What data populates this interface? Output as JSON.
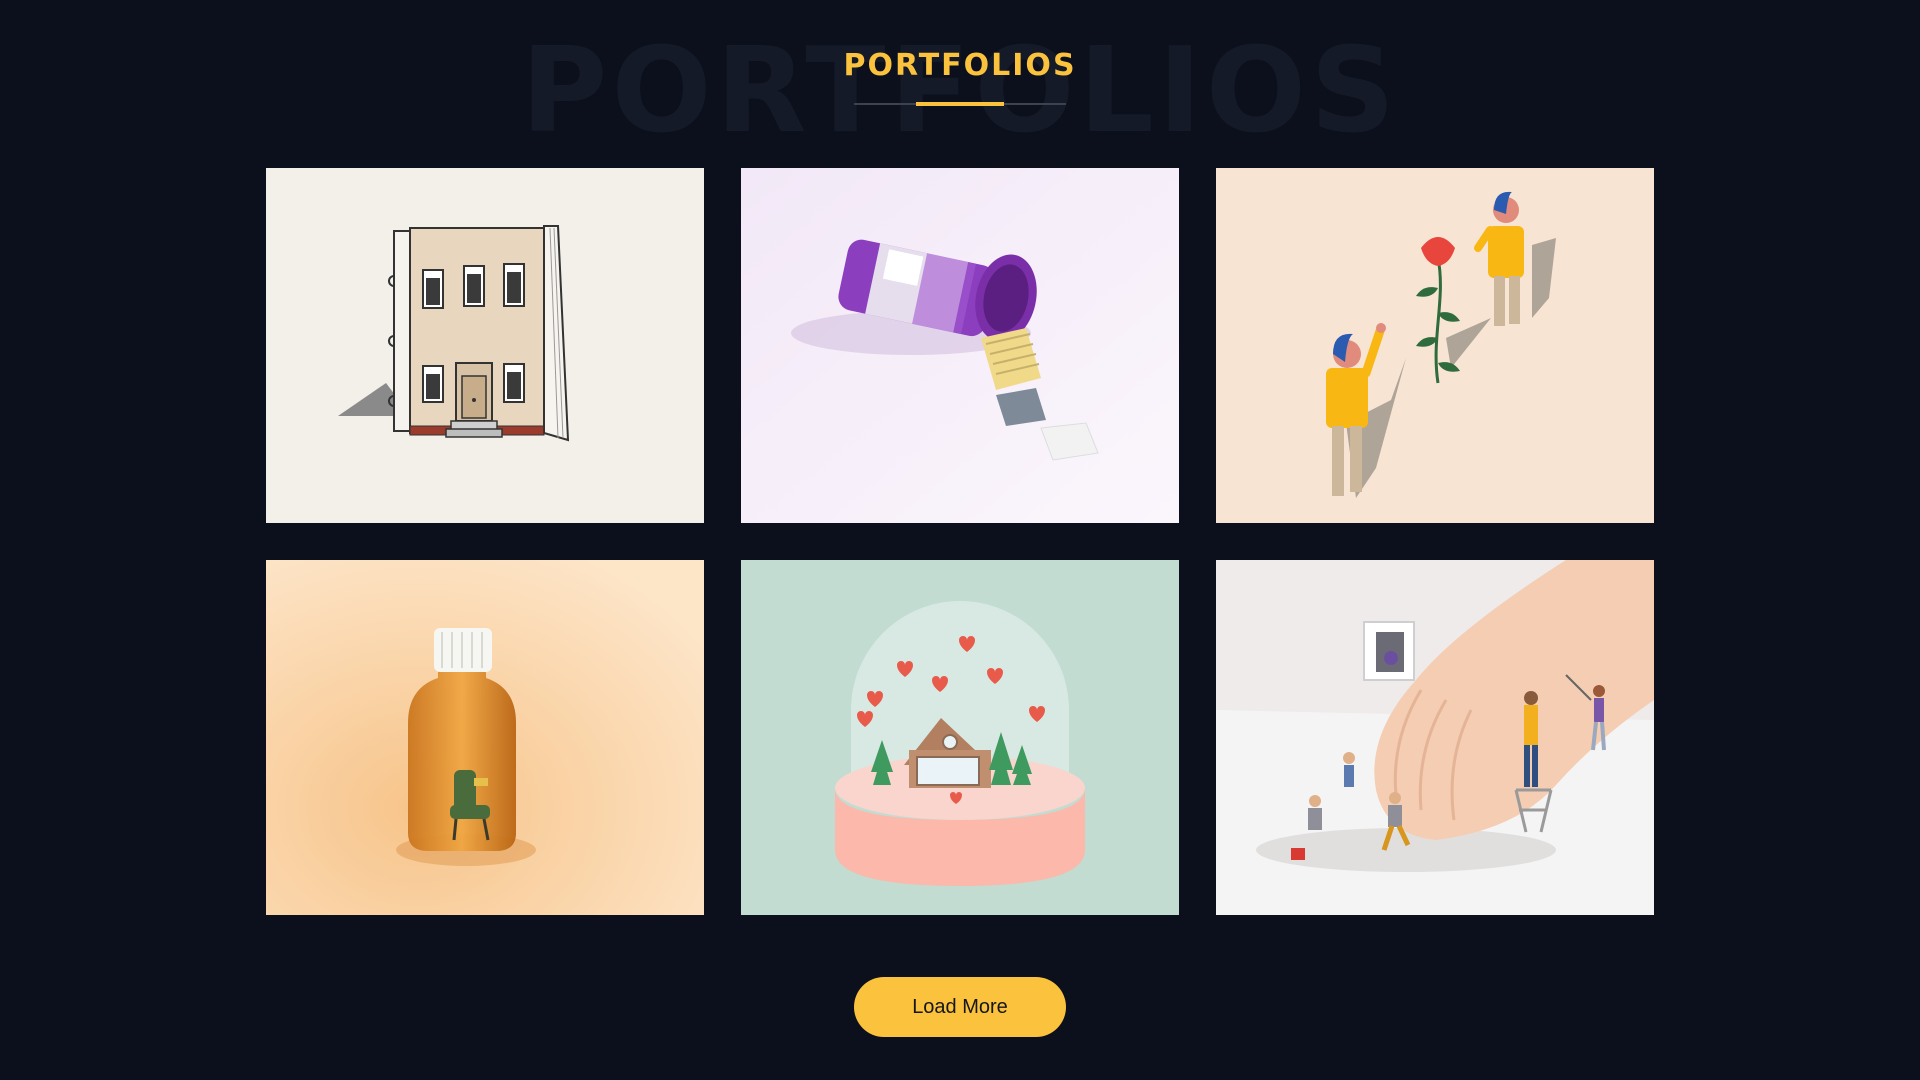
{
  "section": {
    "background_title": "PORTFOLIOS",
    "title": "PORTFOLIOS",
    "accent_color": "#fbc23e",
    "background_color": "#0b101c"
  },
  "portfolio": {
    "items": [
      {
        "illustration": "building-book-illustration",
        "bg": "#f3efe9"
      },
      {
        "illustration": "pill-bottle-illustration",
        "bg": "#eee2f4"
      },
      {
        "illustration": "people-flower-illustration",
        "bg": "#f8e4d3"
      },
      {
        "illustration": "medicine-jar-chair-illustration",
        "bg": "#fbdcb8"
      },
      {
        "illustration": "snow-globe-house-illustration",
        "bg": "#c3dcd2"
      },
      {
        "illustration": "hand-cleaners-illustration",
        "bg": "#eeebea"
      }
    ]
  },
  "actions": {
    "load_more_label": "Load More"
  }
}
